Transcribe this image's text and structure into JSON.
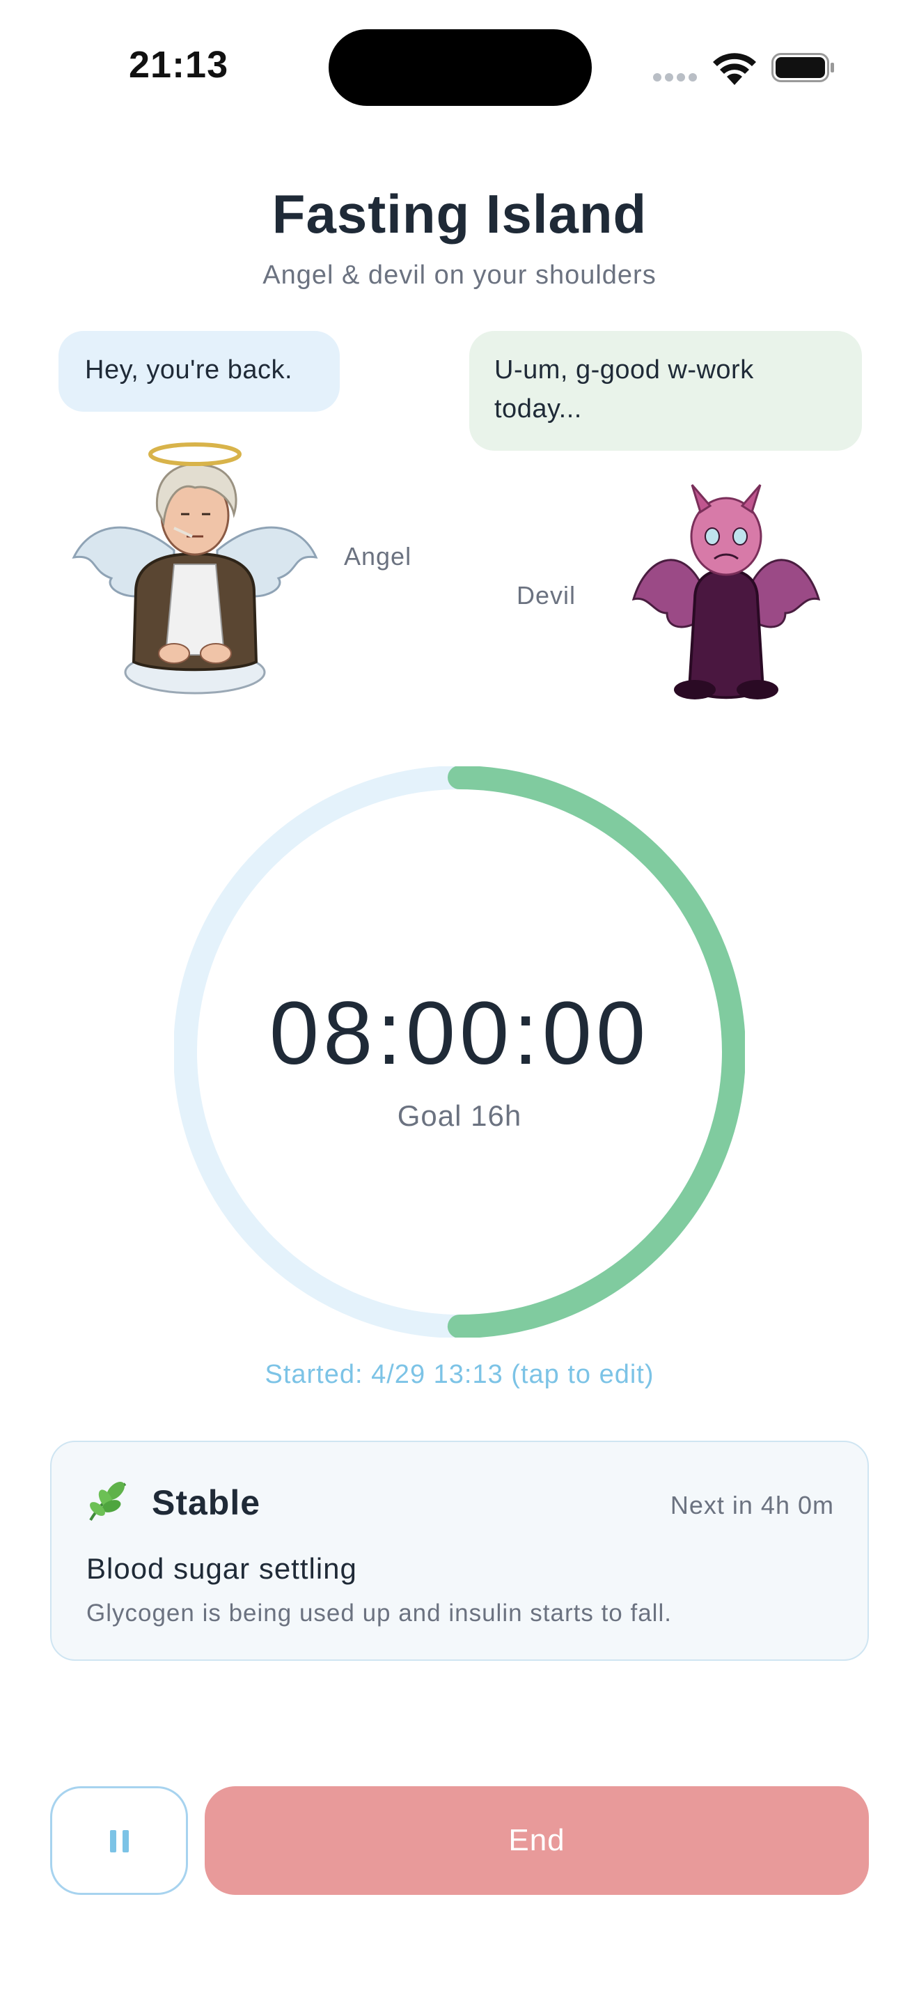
{
  "status_bar": {
    "time": "21:13",
    "icons": [
      "signal-dots-icon",
      "wifi-icon",
      "battery-icon"
    ]
  },
  "header": {
    "title": "Fasting Island",
    "subtitle": "Angel & devil on your shoulders"
  },
  "characters": {
    "angel": {
      "bubble": "Hey, you're back.",
      "label": "Angel",
      "bubble_color": "#e4f1fb"
    },
    "devil": {
      "bubble_line1": "U-um, g-good w-work",
      "bubble_line2": "today...",
      "label": "Devil",
      "bubble_color": "#e9f3ea"
    }
  },
  "timer": {
    "elapsed": "08:00:00",
    "goal": "Goal 16h",
    "progress_fraction": 0.5,
    "progress_color": "#80cb9f",
    "track_color": "#e4f2fb",
    "started": "Started: 4/29 13:13 (tap to edit)"
  },
  "stage": {
    "icon": "herb-leaf-icon",
    "name": "Stable",
    "next": "Next in 4h 0m",
    "headline": "Blood sugar settling",
    "description": "Glycogen is being used up and insulin starts to fall."
  },
  "controls": {
    "pause_icon": "pause-icon",
    "end_label": "End",
    "end_color": "#e89a9a"
  }
}
